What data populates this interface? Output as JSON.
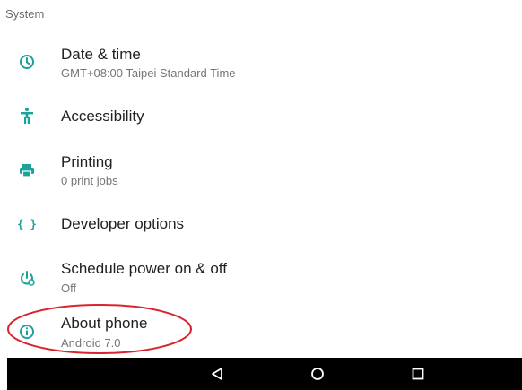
{
  "section": {
    "title": "System"
  },
  "items": [
    {
      "icon": "clock-icon",
      "title": "Date & time",
      "subtitle": "GMT+08:00 Taipei Standard Time"
    },
    {
      "icon": "accessibility-icon",
      "title": "Accessibility",
      "subtitle": ""
    },
    {
      "icon": "printer-icon",
      "title": "Printing",
      "subtitle": "0 print jobs"
    },
    {
      "icon": "braces-icon",
      "title": "Developer options",
      "subtitle": "",
      "icon_glyph": "{ }"
    },
    {
      "icon": "power-schedule-icon",
      "title": "Schedule power on & off",
      "subtitle": "Off"
    },
    {
      "icon": "info-icon",
      "title": "About phone",
      "subtitle": "Android 7.0"
    }
  ],
  "colors": {
    "accent": "#1aa39a",
    "highlight": "#d9232e",
    "navbar": "#000000"
  },
  "navbar": {
    "buttons": [
      "back-icon",
      "home-icon",
      "recents-icon"
    ]
  }
}
